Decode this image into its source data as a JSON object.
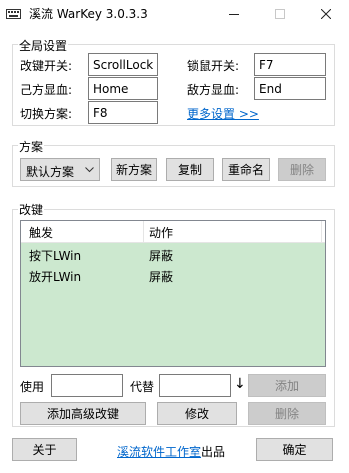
{
  "window": {
    "title": "溪流 WarKey 3.0.3.3",
    "icons": {
      "app": "keyboard-icon",
      "minimize": "minimize-icon",
      "maximize": "maximize-icon",
      "close": "close-icon"
    }
  },
  "global_settings": {
    "group_label": "全局设置",
    "fields": [
      {
        "label": "改键开关:",
        "value": "ScrollLock"
      },
      {
        "label": "锁鼠开关:",
        "value": "F7"
      },
      {
        "label": "己方显血:",
        "value": "Home"
      },
      {
        "label": "敌方显血:",
        "value": "End"
      },
      {
        "label": "切换方案:",
        "value": "F8"
      }
    ],
    "more_settings_link": "更多设置 >>"
  },
  "scheme": {
    "group_label": "方案",
    "selected": "默认方案",
    "buttons": {
      "new": "新方案",
      "copy": "复制",
      "rename": "重命名",
      "delete": "删除"
    }
  },
  "remap": {
    "group_label": "改键",
    "columns": [
      "触发",
      "动作"
    ],
    "rows": [
      {
        "trigger": "按下LWin",
        "action": "屏蔽"
      },
      {
        "trigger": "放开LWin",
        "action": "屏蔽"
      }
    ],
    "use_label": "使用",
    "replace_label": "代替",
    "use_value": "",
    "replace_value": "",
    "arrow": "↓",
    "buttons": {
      "add": "添加",
      "advanced": "添加高级改键",
      "modify": "修改",
      "delete": "删除"
    }
  },
  "footer": {
    "about": "关于",
    "studio_link": "溪流软件工作室",
    "credit_suffix": "出品",
    "ok": "确定"
  },
  "colors": {
    "list_background": "#cce8cf",
    "link": "#0066cc",
    "disabled_button": "#cccccc"
  }
}
